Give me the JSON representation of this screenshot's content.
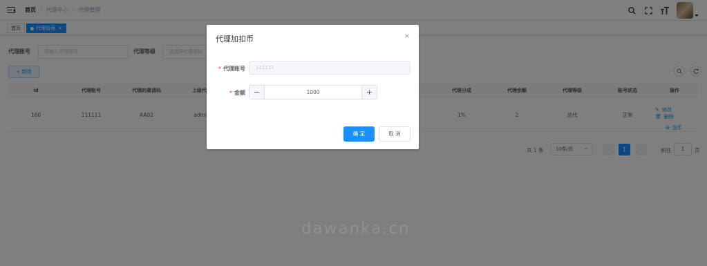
{
  "breadcrumb": [
    "首页",
    "代理中心",
    "代理管理"
  ],
  "tags": [
    {
      "label": "首页"
    },
    {
      "label": "代理管理",
      "close": "×"
    }
  ],
  "search": {
    "account_label": "代理账号",
    "account_placeholder": "请输入代理账号",
    "level_label": "代理等级",
    "level_placeholder": "请选择代理等级"
  },
  "toolbar": {
    "add_label": "+ 新增",
    "icons": [
      "search-icon",
      "refresh-icon"
    ]
  },
  "table": {
    "columns": [
      "id",
      "代理账号",
      "代理的邀请码",
      "上级代理",
      "代理分成",
      "代理余额",
      "代理等级",
      "账号状态",
      "操作"
    ],
    "rows": [
      {
        "id": "160",
        "account": "111111",
        "invite": "AA02",
        "parent": "admin",
        "share": "1%",
        "balance": "2",
        "level": "总代",
        "status": "正常",
        "ops": [
          "修改",
          "删除",
          "加币"
        ]
      }
    ]
  },
  "pagination": {
    "total": "共 1 条",
    "page_size": "10条/页",
    "current": "1",
    "goto_label": "前往",
    "goto_value": "1",
    "page_suffix": "页"
  },
  "dialog": {
    "title": "代理加扣币",
    "close": "×",
    "account_label": "代理账号",
    "account_placeholder": "111111",
    "amount_label": "金额",
    "amount_value": "1000",
    "minus": "−",
    "plus": "+",
    "required_mark": "*",
    "confirm": "确 定",
    "cancel": "取 消"
  },
  "watermark": "dawanka.cn",
  "colors": {
    "primary": "#1890ff",
    "danger": "#f56c6c",
    "mask": "rgba(0,0,0,0.5)"
  }
}
